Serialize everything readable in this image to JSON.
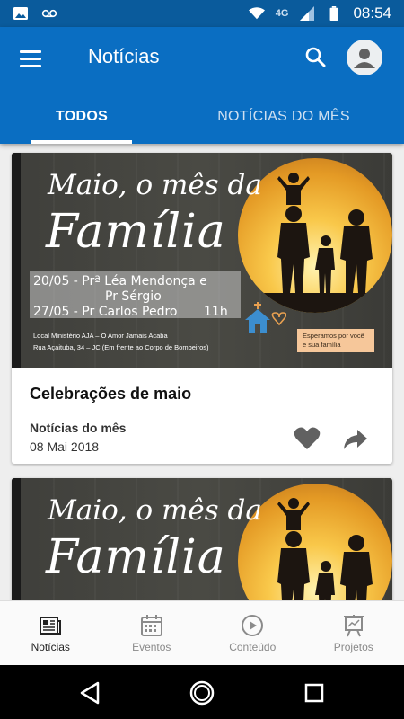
{
  "status_bar": {
    "network": "4G",
    "time": "08:54"
  },
  "app_bar": {
    "title": "Notícias",
    "icons": {
      "menu": "menu-icon",
      "search": "search-icon",
      "account": "account-icon"
    }
  },
  "tabs": [
    {
      "label": "TODOS",
      "active": true
    },
    {
      "label": "NOTÍCIAS DO MÊS",
      "active": false
    }
  ],
  "banner": {
    "script_line1": "Maio, o mês da",
    "script_line2": "Família",
    "line1": "20/05 - Prª Léa Mendonça e",
    "line2": "Pr Sérgio",
    "line3_name": "27/05 - Pr Carlos Pedro",
    "line3_time": "11h",
    "address1": "Local  Ministério AJA – O Amor  Jamais Acaba",
    "address2": "Rua Açaituba, 34 – JC (Em frente ao Corpo de Bombeiros)",
    "tag_line1": "Esperamos por você",
    "tag_line2": "e sua família"
  },
  "cards": [
    {
      "title": "Celebrações de maio",
      "category": "Notícias do mês",
      "date": "08 Mai 2018"
    }
  ],
  "bottom_nav": [
    {
      "label": "Notícias",
      "icon": "news-icon",
      "active": true
    },
    {
      "label": "Eventos",
      "icon": "calendar-icon",
      "active": false
    },
    {
      "label": "Conteúdo",
      "icon": "play-icon",
      "active": false
    },
    {
      "label": "Projetos",
      "icon": "presentation-icon",
      "active": false
    }
  ],
  "colors": {
    "primary": "#0a6ec2",
    "primary_dark": "#0a5b9c",
    "accent_tag": "#f6c79a"
  }
}
